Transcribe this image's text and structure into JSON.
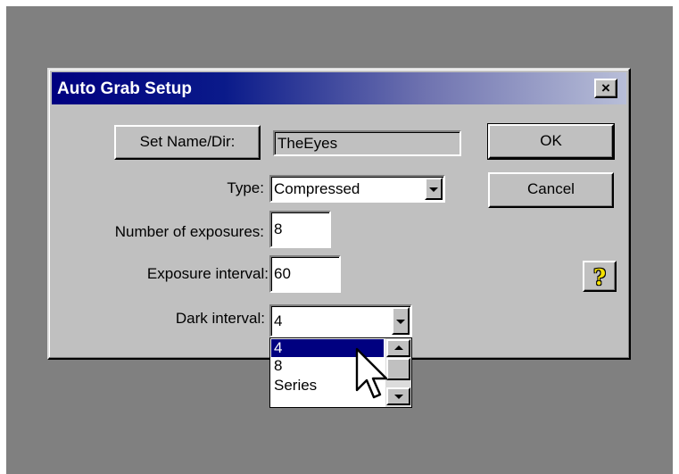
{
  "dialog": {
    "title": "Auto Grab Setup",
    "close_label": "×",
    "set_name_button": "Set Name/Dir:",
    "name_value": "TheEyes",
    "ok_button": "OK",
    "cancel_button": "Cancel",
    "type": {
      "label": "Type:",
      "value": "Compressed"
    },
    "exposures": {
      "label": "Number of exposures:",
      "value": "8"
    },
    "exposure_interval": {
      "label": "Exposure interval:",
      "value": "60"
    },
    "dark_interval": {
      "label": "Dark interval:",
      "value": "4",
      "options": [
        "4",
        "8",
        "Series"
      ],
      "selected_option": "4"
    },
    "help_icon": "help-question-icon",
    "help_glyph": "?"
  },
  "colors": {
    "desktop": "#808080",
    "dialog_face": "#c0c0c0",
    "titlebar_start": "#000080",
    "titlebar_end": "#b8bed8",
    "selection": "#000080",
    "help_yellow": "#f4e000"
  },
  "icons": {
    "close": "close-icon",
    "combo_arrow": "chevron-down-icon",
    "scroll_up": "arrow-up-icon",
    "scroll_down": "arrow-down-icon",
    "cursor": "mouse-pointer-icon"
  }
}
